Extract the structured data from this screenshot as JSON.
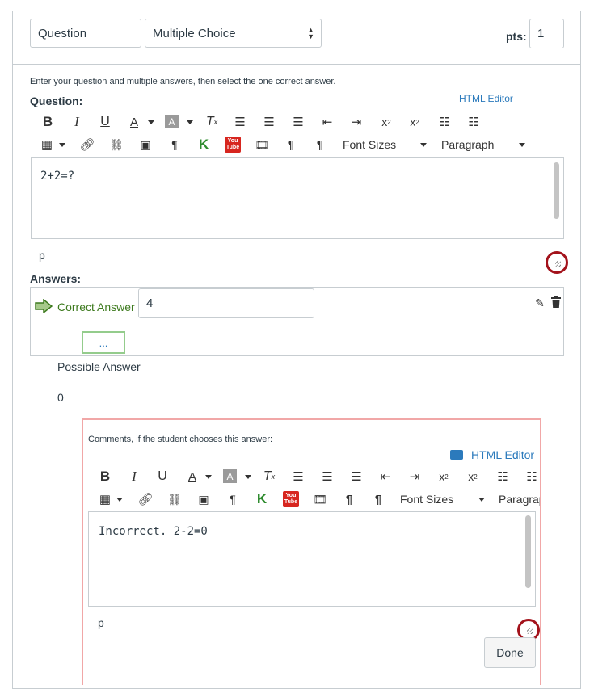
{
  "header": {
    "question_name": "Question",
    "question_type": "Multiple Choice",
    "points_label": "pts:",
    "points_value": "1"
  },
  "instructions": "Enter your question and multiple answers, then select the one correct answer.",
  "question": {
    "label": "Question:",
    "html_editor_link": "HTML Editor",
    "font_sizes_label": "Font Sizes",
    "paragraph_label": "Paragraph",
    "content": "2+2=?",
    "path": "p"
  },
  "answers": {
    "label": "Answers:",
    "correct_answer_label": "Correct Answer",
    "correct_answer_value": "4",
    "comment_toggle": "...",
    "possible_answer_label": "Possible Answer",
    "possible_answer_value": "0"
  },
  "comments": {
    "label": "Comments, if the student chooses this answer:",
    "html_editor_link": "HTML Editor",
    "font_sizes_label": "Font Sizes",
    "paragraph_label": "Paragrap",
    "content": "Incorrect. 2-2=0",
    "path": "p",
    "done_label": "Done"
  },
  "icons": {
    "toolbar_row1": [
      "bold-icon",
      "italic-icon",
      "underline-icon",
      "text-color-icon",
      "background-color-icon",
      "clear-formatting-icon",
      "align-left-icon",
      "align-center-icon",
      "align-right-icon",
      "outdent-icon",
      "indent-icon",
      "superscript-icon",
      "subscript-icon",
      "bullet-list-icon",
      "numbered-list-icon"
    ],
    "toolbar_row2": [
      "table-icon",
      "link-icon",
      "unlink-icon",
      "image-icon",
      "paragraph-mark-icon",
      "kaltura-icon",
      "youtube-icon",
      "media-icon",
      "ltr-icon",
      "rtl-icon"
    ]
  },
  "colors": {
    "correct_green": "#3d7a1e",
    "link_blue": "#2b7abc",
    "highlight_red": "#a3121b"
  }
}
